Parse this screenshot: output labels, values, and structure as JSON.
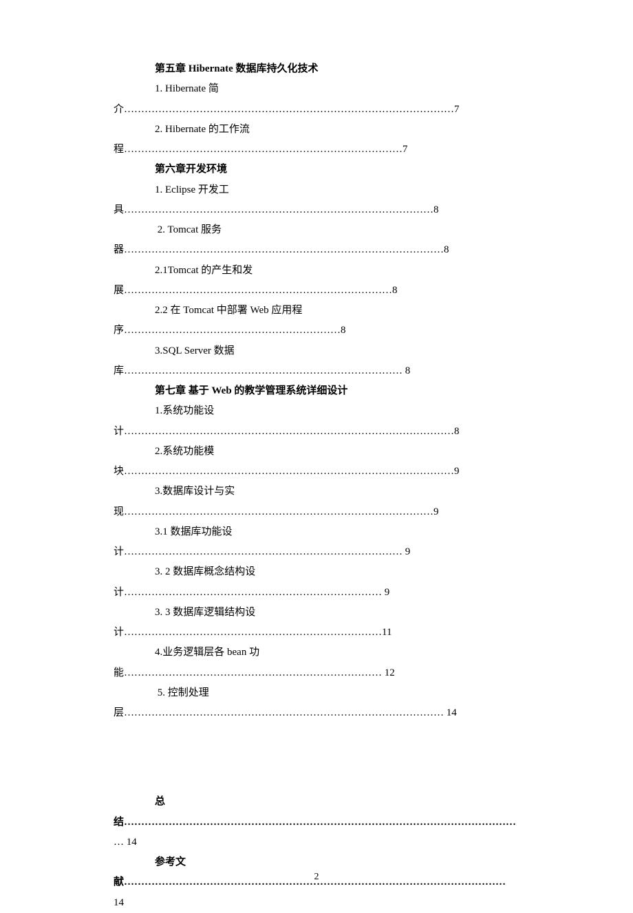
{
  "entries": [
    {
      "bold": true,
      "indent": true,
      "text": "第五章 Hibernate 数据库持久化技术"
    },
    {
      "bold": false,
      "indent": true,
      "text": "1. Hibernate 简"
    },
    {
      "bold": false,
      "indent": false,
      "text": "介……………………………………………………………………………………7"
    },
    {
      "bold": false,
      "indent": true,
      "text": "2. Hibernate 的工作流"
    },
    {
      "bold": false,
      "indent": false,
      "text": "程………………………………………………………………………7"
    },
    {
      "bold": true,
      "indent": true,
      "text": "第六章开发环境"
    },
    {
      "bold": false,
      "indent": true,
      "text": "1. Eclipse 开发工"
    },
    {
      "bold": false,
      "indent": false,
      "text": "具………………………………………………………………………………8"
    },
    {
      "bold": false,
      "indent": true,
      "text": " 2. Tomcat 服务"
    },
    {
      "bold": false,
      "indent": false,
      "text": "器…………………………………………………………………………………8"
    },
    {
      "bold": false,
      "indent": true,
      "text": "2.1Tomcat 的产生和发"
    },
    {
      "bold": false,
      "indent": false,
      "text": "展……………………………………………………………………8"
    },
    {
      "bold": false,
      "indent": true,
      "text": "2.2  在 Tomcat 中部署 Web 应用程"
    },
    {
      "bold": false,
      "indent": false,
      "text": "序………………………………………………………8"
    },
    {
      "bold": false,
      "indent": true,
      "text": "3.SQL Server 数据"
    },
    {
      "bold": false,
      "indent": false,
      "text": "库……………………………………………………………………… 8"
    },
    {
      "bold": true,
      "indent": true,
      "text": "第七章 基于 Web 的教学管理系统详细设计"
    },
    {
      "bold": false,
      "indent": true,
      "text": "1.系统功能设"
    },
    {
      "bold": false,
      "indent": false,
      "text": "计……………………………………………………………………………………8"
    },
    {
      "bold": false,
      "indent": true,
      "text": "2.系统功能模"
    },
    {
      "bold": false,
      "indent": false,
      "text": "块……………………………………………………………………………………9"
    },
    {
      "bold": false,
      "indent": true,
      "text": "3.数据库设计与实"
    },
    {
      "bold": false,
      "indent": false,
      "text": "现………………………………………………………………………………9"
    },
    {
      "bold": false,
      "indent": true,
      "text": "3.1 数据库功能设"
    },
    {
      "bold": false,
      "indent": false,
      "text": "计……………………………………………………………………… 9"
    },
    {
      "bold": false,
      "indent": true,
      "text": "3. 2  数据库概念结构设"
    },
    {
      "bold": false,
      "indent": false,
      "text": "计………………………………………………………………… 9"
    },
    {
      "bold": false,
      "indent": true,
      "text": "3. 3 数据库逻辑结构设"
    },
    {
      "bold": false,
      "indent": false,
      "text": "计…………………………………………………………………11"
    },
    {
      "bold": false,
      "indent": true,
      "text": "4.业务逻辑层各 bean 功"
    },
    {
      "bold": false,
      "indent": false,
      "text": "能………………………………………………………………… 12"
    },
    {
      "bold": false,
      "indent": true,
      "text": " 5. 控制处理"
    },
    {
      "bold": false,
      "indent": false,
      "text": "层………………………………………………………………………………… 14"
    }
  ],
  "footer": [
    {
      "bold": true,
      "indent": true,
      "text": "总"
    },
    {
      "bold": true,
      "indent": false,
      "text": "结……………………………………………………………………………………………………"
    },
    {
      "bold": false,
      "indent": false,
      "text": "… 14"
    },
    {
      "bold": true,
      "indent": true,
      "text": "参考文"
    },
    {
      "bold": true,
      "indent": false,
      "text": "献…………………………………………………………………………………………………"
    },
    {
      "bold": false,
      "indent": false,
      "text": "14"
    }
  ],
  "pageNumber": "2"
}
